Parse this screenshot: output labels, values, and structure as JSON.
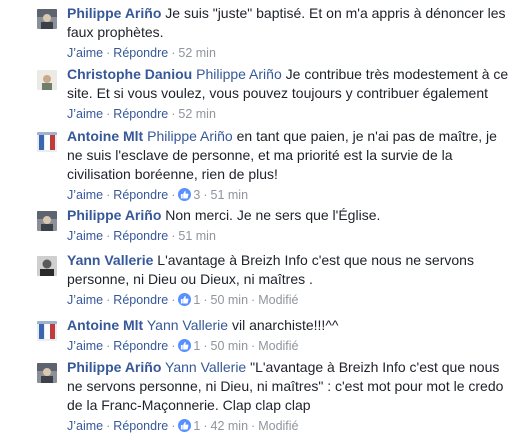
{
  "actions": {
    "like": "J’aime",
    "reply": "Répondre",
    "modified": "Modifié",
    "separator": "·"
  },
  "comments": [
    {
      "author": "Philippe Ariño",
      "mention": "",
      "text": "Je suis \"juste\" baptisé. Et on m'a appris à dénoncer les faux prophètes.",
      "likes": "",
      "time": "52 min",
      "modified": false
    },
    {
      "author": "Christophe Daniou",
      "mention": "Philippe Ariño",
      "text": "Je contribue très modestement à ce site. Et si vous voulez, vous pouvez toujours y contribuer également",
      "likes": "",
      "time": "52 min",
      "modified": false
    },
    {
      "author": "Antoine Mlt",
      "mention": "Philippe Ariño",
      "text": "en tant que paien, je n'ai pas de maître, je ne suis l'esclave de personne, et ma priorité est la survie de la civilisation boréenne, rien de plus!",
      "likes": "3",
      "time": "51 min",
      "modified": false
    },
    {
      "author": "Philippe Ariño",
      "mention": "",
      "text": "Non merci. Je ne sers que l'Église.",
      "likes": "",
      "time": "51 min",
      "modified": false
    },
    {
      "author": "Yann Vallerie",
      "mention": "",
      "text": "L'avantage à Breizh Info c'est que nous ne servons personne, ni Dieu ou Dieux, ni maîtres .",
      "likes": "1",
      "time": "50 min",
      "modified": true
    },
    {
      "author": "Antoine Mlt",
      "mention": "Yann Vallerie",
      "text": "vil anarchiste!!!^^",
      "likes": "1",
      "time": "50 min",
      "modified": true
    },
    {
      "author": "Philippe Ariño",
      "mention": "Yann Vallerie",
      "text": "\"L'avantage à Breizh Info c'est que nous ne servons personne, ni Dieu, ni maîtres\" : c'est mot pour mot le credo de la Franc-Maçonnerie. Clap clap clap",
      "likes": "1",
      "time": "42 min",
      "modified": true
    }
  ]
}
